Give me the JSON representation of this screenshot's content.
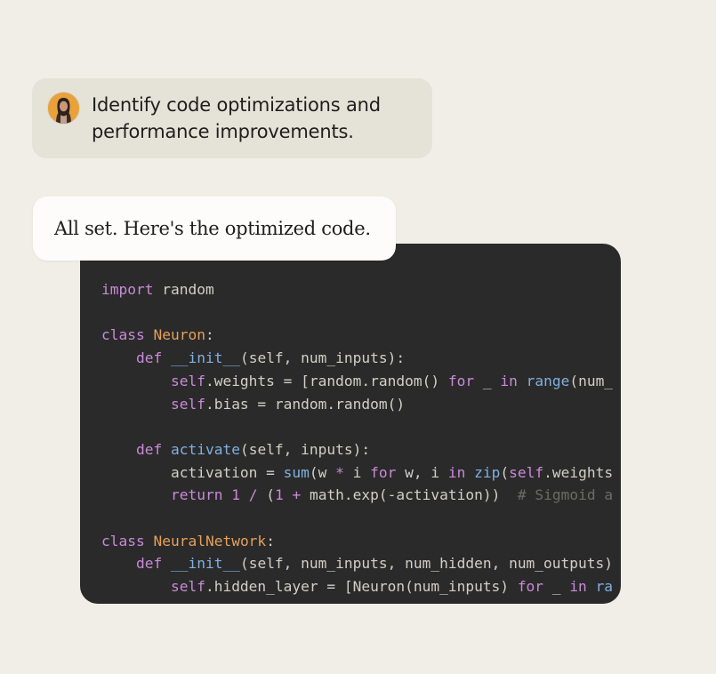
{
  "user_message": {
    "text": "Identify code optimizations and performance improvements.",
    "avatar": "user-avatar-photo"
  },
  "assistant_message": {
    "text": "All set. Here's the optimized code."
  },
  "code_block": {
    "language": "python",
    "lines": [
      "import random",
      "",
      "class Neuron:",
      "    def __init__(self, num_inputs):",
      "        self.weights = [random.random() for _ in range(num_",
      "        self.bias = random.random()",
      "",
      "    def activate(self, inputs):",
      "        activation = sum(w * i for w, i in zip(self.weights",
      "        return 1 / (1 + math.exp(-activation))  # Sigmoid a",
      "",
      "class NeuralNetwork:",
      "    def __init__(self, num_inputs, num_hidden, num_outputs)",
      "        self.hidden_layer = [Neuron(num_inputs) for _ in ra"
    ]
  },
  "colors": {
    "background": "#f0eee6",
    "user_bubble": "#e5e2d8",
    "assistant_bubble": "#fdfcfa",
    "code_background": "#2a2a2a",
    "keyword": "#c98ad8",
    "class_name": "#e6a05a",
    "function": "#7fb0e0",
    "comment": "#6c6b67"
  }
}
